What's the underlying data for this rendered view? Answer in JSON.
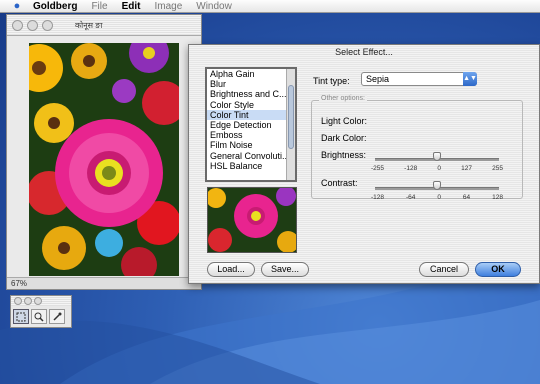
{
  "menubar": {
    "app_name": "Goldberg",
    "items": [
      "File",
      "Edit",
      "Image",
      "Window"
    ]
  },
  "document": {
    "title": "कोनूस ङा",
    "zoom": "67%"
  },
  "dialog": {
    "title": "Select Effect...",
    "effects": [
      "Alpha Gain",
      "Blur",
      "Brightness and C...",
      "Color Style",
      "Color Tint",
      "Edge Detection",
      "Emboss",
      "Film Noise",
      "General Convoluti...",
      "HSL Balance"
    ],
    "selected_effect": "Color Tint",
    "tint_type_label": "Tint type:",
    "tint_type_value": "Sepia",
    "other_options_label": "Other options:",
    "light_color_label": "Light Color:",
    "dark_color_label": "Dark Color:",
    "brightness_label": "Brightness:",
    "brightness_ticks": [
      "-255",
      "-128",
      "0",
      "127",
      "255"
    ],
    "brightness_value": 0,
    "contrast_label": "Contrast:",
    "contrast_ticks": [
      "-128",
      "-64",
      "0",
      "64",
      "128"
    ],
    "contrast_value": 0,
    "buttons": {
      "load": "Load...",
      "save": "Save...",
      "cancel": "Cancel",
      "ok": "OK"
    }
  },
  "colors": {
    "accent": "#3f7fde",
    "selection": "#c9dcf5",
    "desktop": "#2e5fb4"
  },
  "icons": [
    "apple-icon",
    "marquee-tool-icon",
    "zoom-tool-icon",
    "eyedropper-tool-icon"
  ]
}
